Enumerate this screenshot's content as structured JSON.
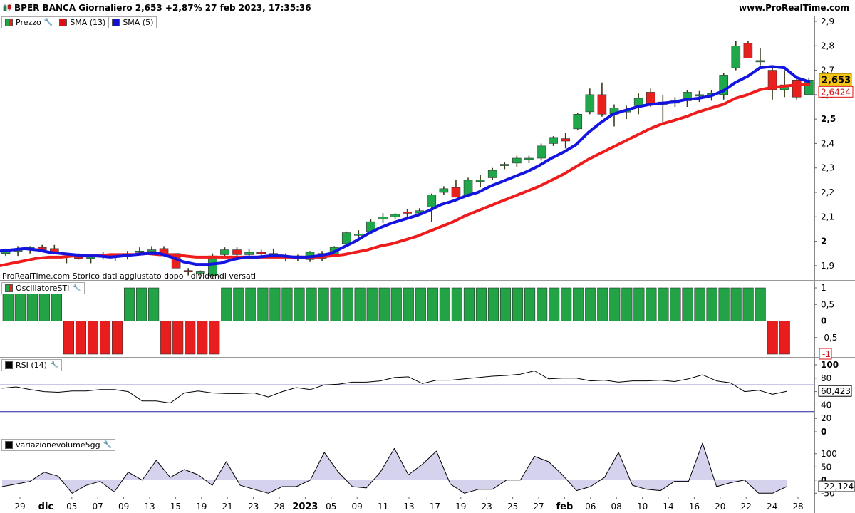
{
  "header": {
    "title": "BPER BANCA Giornaliero 2,653 +2,87% 27 feb 2023, 17:35:36",
    "brand": "www.ProRealTime.com"
  },
  "note": "ProRealTime.com  Storico dati aggiustato dopo i dividendi versati",
  "colors": {
    "up": "#1fa84a",
    "down": "#e8201e",
    "sma13": "#ee1c1c",
    "sma5": "#1414e0",
    "sti_up": "#22a345",
    "sti_down": "#e81e1e",
    "rsi_band": "#2020a0",
    "vol_fill": "#d4d2ec"
  },
  "legends": {
    "price": [
      {
        "label": "Prezzo",
        "icon": "candle-icon"
      },
      {
        "label": "SMA (13)",
        "color": "#e01010"
      },
      {
        "label": "SMA (5)",
        "color": "#1010d0"
      }
    ],
    "sti": "OscillatoreSTI",
    "rsi": "RSI (14)",
    "vol": "variazionevolume5gg"
  },
  "chart_data": [
    {
      "type": "candlestick",
      "x_labels": [
        "29",
        "dic",
        "05",
        "07",
        "09",
        "13",
        "15",
        "19",
        "21",
        "23",
        "28",
        "2023",
        "05",
        "09",
        "11",
        "13",
        "17",
        "19",
        "23",
        "25",
        "27",
        "feb",
        "06",
        "08",
        "10",
        "14",
        "16",
        "20",
        "22",
        "24",
        "28"
      ],
      "ylim": [
        1.85,
        2.9
      ],
      "y_ticks": [
        "1,9",
        "2",
        "2,1",
        "2,2",
        "2,3",
        "2,4",
        "2,5",
        "2,6",
        "2,7",
        "2,8",
        "2,9"
      ],
      "last_price_label": "2,653",
      "sma13_label": "2,6424",
      "candles": [
        [
          1.95,
          1.97,
          1.94,
          1.96
        ],
        [
          1.96,
          1.98,
          1.94,
          1.965
        ],
        [
          1.965,
          1.98,
          1.95,
          1.975
        ],
        [
          1.975,
          1.985,
          1.96,
          1.965
        ],
        [
          1.97,
          1.985,
          1.95,
          1.95
        ],
        [
          1.94,
          1.95,
          1.91,
          1.935
        ],
        [
          1.935,
          1.95,
          1.925,
          1.93
        ],
        [
          1.93,
          1.945,
          1.91,
          1.935
        ],
        [
          1.94,
          1.955,
          1.925,
          1.935
        ],
        [
          1.935,
          1.95,
          1.92,
          1.94
        ],
        [
          1.945,
          1.96,
          1.925,
          1.95
        ],
        [
          1.955,
          1.975,
          1.95,
          1.96
        ],
        [
          1.965,
          1.98,
          1.96,
          1.965
        ],
        [
          1.97,
          1.98,
          1.95,
          1.95
        ],
        [
          1.95,
          1.95,
          1.89,
          1.89
        ],
        [
          1.88,
          1.89,
          1.86,
          1.875
        ],
        [
          1.87,
          1.88,
          1.86,
          1.875
        ],
        [
          1.86,
          1.95,
          1.85,
          1.94
        ],
        [
          1.945,
          1.975,
          1.94,
          1.965
        ],
        [
          1.965,
          1.975,
          1.94,
          1.945
        ],
        [
          1.945,
          1.97,
          1.93,
          1.955
        ],
        [
          1.955,
          1.965,
          1.94,
          1.95
        ],
        [
          1.95,
          1.97,
          1.93,
          1.95
        ],
        [
          1.94,
          1.95,
          1.92,
          1.94
        ],
        [
          1.94,
          1.945,
          1.92,
          1.93
        ],
        [
          1.925,
          1.96,
          1.915,
          1.955
        ],
        [
          1.93,
          1.96,
          1.92,
          1.95
        ],
        [
          1.94,
          1.98,
          1.935,
          1.975
        ],
        [
          1.99,
          2.04,
          1.985,
          2.035
        ],
        [
          2.025,
          2.045,
          2.015,
          2.03
        ],
        [
          2.04,
          2.09,
          2.035,
          2.08
        ],
        [
          2.09,
          2.115,
          2.075,
          2.1
        ],
        [
          2.1,
          2.115,
          2.09,
          2.11
        ],
        [
          2.12,
          2.13,
          2.1,
          2.115
        ],
        [
          2.115,
          2.135,
          2.105,
          2.125
        ],
        [
          2.14,
          2.195,
          2.08,
          2.19
        ],
        [
          2.2,
          2.225,
          2.19,
          2.215
        ],
        [
          2.22,
          2.25,
          2.18,
          2.18
        ],
        [
          2.19,
          2.26,
          2.18,
          2.25
        ],
        [
          2.25,
          2.27,
          2.22,
          2.25
        ],
        [
          2.26,
          2.3,
          2.25,
          2.29
        ],
        [
          2.31,
          2.325,
          2.295,
          2.315
        ],
        [
          2.32,
          2.35,
          2.305,
          2.34
        ],
        [
          2.335,
          2.35,
          2.32,
          2.34
        ],
        [
          2.34,
          2.4,
          2.33,
          2.39
        ],
        [
          2.4,
          2.43,
          2.39,
          2.425
        ],
        [
          2.42,
          2.445,
          2.38,
          2.41
        ],
        [
          2.46,
          2.525,
          2.455,
          2.52
        ],
        [
          2.53,
          2.625,
          2.52,
          2.6
        ],
        [
          2.6,
          2.65,
          2.51,
          2.52
        ],
        [
          2.52,
          2.56,
          2.47,
          2.545
        ],
        [
          2.535,
          2.555,
          2.5,
          2.535
        ],
        [
          2.555,
          2.605,
          2.52,
          2.585
        ],
        [
          2.61,
          2.625,
          2.55,
          2.56
        ],
        [
          2.56,
          2.6,
          2.48,
          2.57
        ],
        [
          2.565,
          2.59,
          2.55,
          2.575
        ],
        [
          2.575,
          2.62,
          2.55,
          2.61
        ],
        [
          2.6,
          2.615,
          2.57,
          2.6
        ],
        [
          2.6,
          2.62,
          2.575,
          2.605
        ],
        [
          2.6,
          2.69,
          2.58,
          2.68
        ],
        [
          2.71,
          2.82,
          2.7,
          2.8
        ],
        [
          2.81,
          2.82,
          2.75,
          2.75
        ],
        [
          2.74,
          2.79,
          2.72,
          2.74
        ],
        [
          2.7,
          2.72,
          2.58,
          2.62
        ],
        [
          2.62,
          2.7,
          2.59,
          2.64
        ],
        [
          2.66,
          2.67,
          2.58,
          2.59
        ],
        [
          2.6,
          2.67,
          2.6,
          2.66
        ]
      ],
      "sma13": [
        1.9,
        1.91,
        1.92,
        1.93,
        1.935,
        1.935,
        1.94,
        1.94,
        1.94,
        1.945,
        1.945,
        1.945,
        1.95,
        1.945,
        1.945,
        1.94,
        1.935,
        1.935,
        1.935,
        1.935,
        1.935,
        1.935,
        1.935,
        1.935,
        1.935,
        1.935,
        1.935,
        1.94,
        1.945,
        1.955,
        1.965,
        1.98,
        1.99,
        2.005,
        2.02,
        2.04,
        2.06,
        2.08,
        2.105,
        2.125,
        2.145,
        2.165,
        2.185,
        2.205,
        2.225,
        2.25,
        2.275,
        2.305,
        2.335,
        2.36,
        2.385,
        2.41,
        2.435,
        2.46,
        2.48,
        2.495,
        2.51,
        2.53,
        2.545,
        2.56,
        2.585,
        2.6,
        2.62,
        2.63,
        2.635,
        2.64,
        2.6424
      ],
      "sma5": [
        1.96,
        1.965,
        1.97,
        1.965,
        1.955,
        1.95,
        1.945,
        1.94,
        1.94,
        1.935,
        1.94,
        1.945,
        1.95,
        1.95,
        1.935,
        1.915,
        1.905,
        1.905,
        1.91,
        1.925,
        1.935,
        1.935,
        1.94,
        1.94,
        1.935,
        1.935,
        1.94,
        1.95,
        1.975,
        2.0,
        2.03,
        2.055,
        2.075,
        2.09,
        2.105,
        2.125,
        2.15,
        2.165,
        2.185,
        2.2,
        2.225,
        2.245,
        2.265,
        2.285,
        2.31,
        2.34,
        2.365,
        2.395,
        2.445,
        2.485,
        2.52,
        2.535,
        2.55,
        2.56,
        2.565,
        2.57,
        2.58,
        2.585,
        2.595,
        2.615,
        2.65,
        2.675,
        2.71,
        2.715,
        2.71,
        2.67,
        2.653
      ]
    },
    {
      "type": "bar",
      "name": "OscillatoreSTI",
      "ylim": [
        -1,
        1
      ],
      "y_ticks": [
        "1",
        "0,5",
        "0",
        "-0,5"
      ],
      "last_label": "-1",
      "values": [
        1,
        1,
        1,
        1,
        1,
        -1,
        -1,
        -1,
        -1,
        -1,
        1,
        1,
        1,
        -1,
        -1,
        -1,
        -1,
        -1,
        1,
        1,
        1,
        1,
        1,
        1,
        1,
        1,
        1,
        1,
        1,
        1,
        1,
        1,
        1,
        1,
        1,
        1,
        1,
        1,
        1,
        1,
        1,
        1,
        1,
        1,
        1,
        1,
        1,
        1,
        1,
        1,
        1,
        1,
        1,
        1,
        1,
        1,
        1,
        1,
        1,
        1,
        1,
        1,
        1,
        -1,
        -1
      ]
    },
    {
      "type": "line",
      "name": "RSI (14)",
      "ylim": [
        0,
        100
      ],
      "y_ticks": [
        "100",
        "80",
        "60",
        "40",
        "20",
        "0"
      ],
      "bands": [
        70,
        30
      ],
      "last_label": "60,423",
      "values": [
        65,
        67,
        63,
        60,
        59,
        61,
        61,
        63,
        63,
        60,
        46,
        46,
        43,
        58,
        61,
        58,
        57,
        57,
        58,
        52,
        60,
        66,
        63,
        70,
        71,
        74,
        74,
        76,
        81,
        82,
        72,
        77,
        77,
        79,
        81,
        83,
        84,
        86,
        91,
        79,
        80,
        80,
        76,
        77,
        74,
        76,
        76,
        77,
        75,
        79,
        85,
        76,
        73,
        60,
        62,
        56,
        60.4
      ]
    },
    {
      "type": "area",
      "name": "variazionevolume5gg",
      "ylim": [
        -60,
        140
      ],
      "y_ticks": [
        "100",
        "50",
        "0",
        "-50"
      ],
      "last_label": "-22,124",
      "values": [
        -25,
        -15,
        -5,
        30,
        15,
        -50,
        -20,
        -5,
        -45,
        30,
        0,
        75,
        10,
        40,
        20,
        -20,
        70,
        -20,
        -35,
        -50,
        -25,
        -25,
        0,
        105,
        30,
        -25,
        -30,
        30,
        120,
        20,
        60,
        110,
        -15,
        -50,
        -35,
        -35,
        0,
        0,
        90,
        70,
        20,
        -40,
        -25,
        10,
        105,
        -20,
        -35,
        -40,
        -5,
        -5,
        140,
        -25,
        -10,
        0,
        -50,
        -50,
        -25
      ]
    }
  ]
}
